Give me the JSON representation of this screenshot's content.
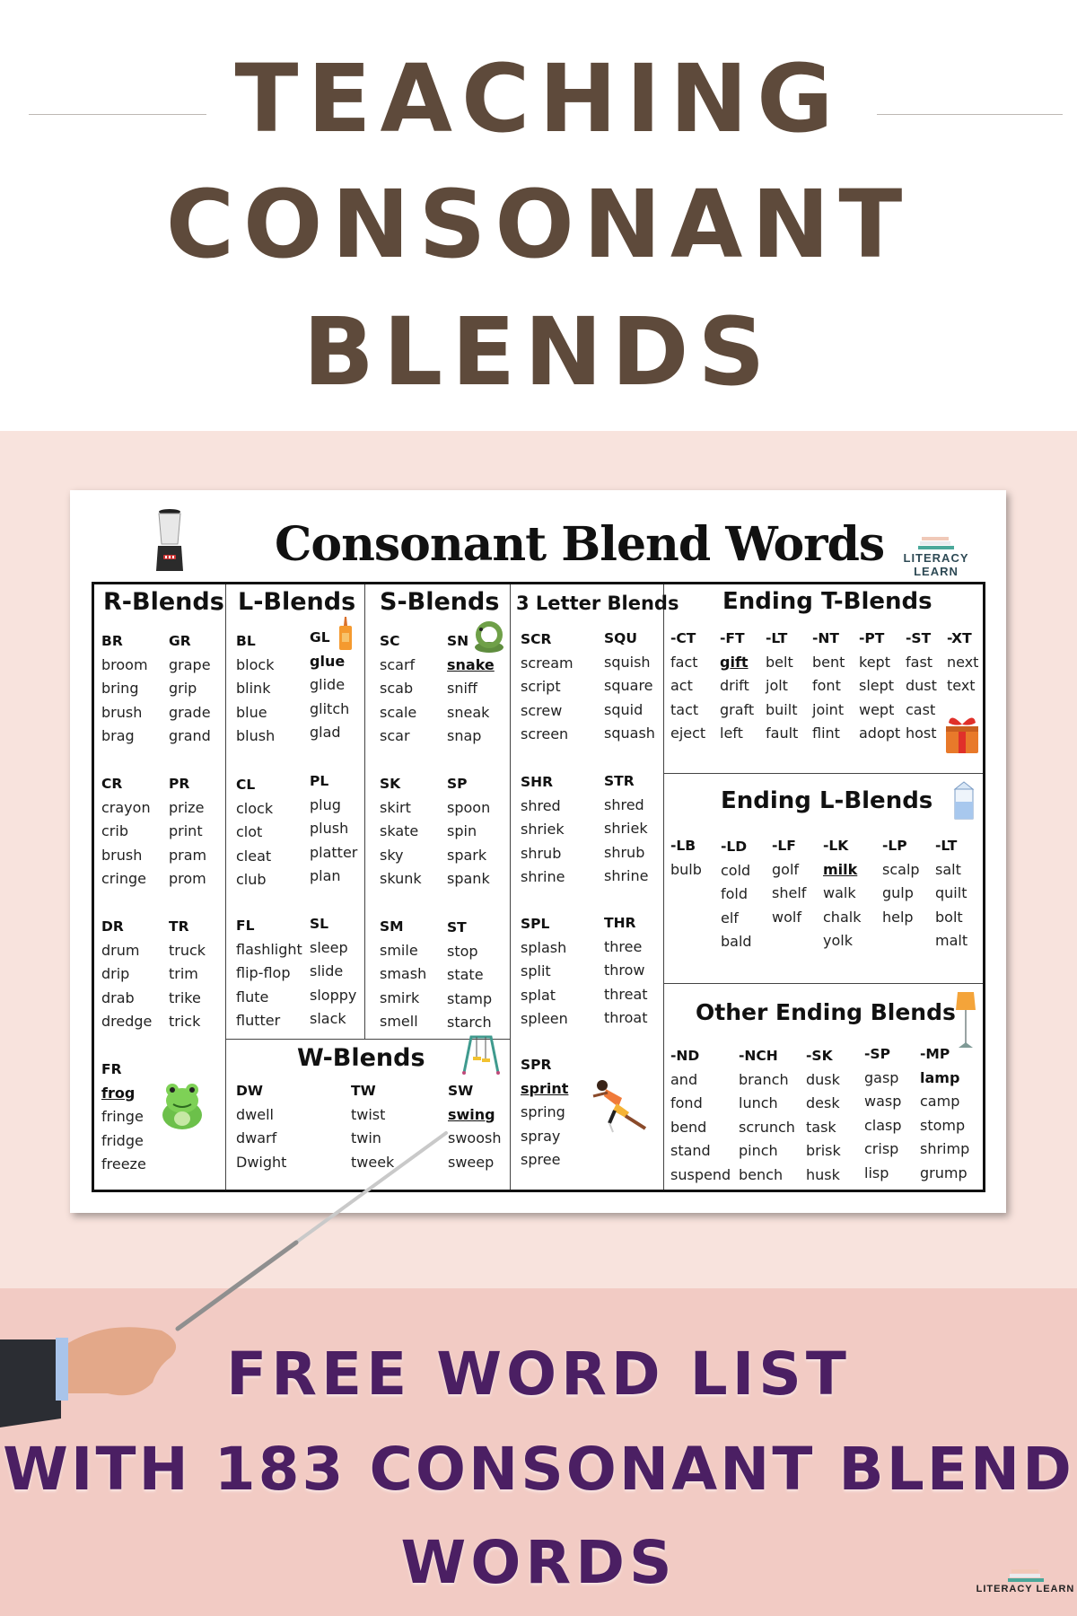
{
  "header": {
    "title_lines": [
      "TEACHING",
      "CONSONANT",
      "BLENDS"
    ]
  },
  "worksheet": {
    "title": "Consonant Blend Words",
    "brand": "LITERACY LEARN",
    "icons": {
      "blender": "blender-icon",
      "glue": "glue-bottle-icon",
      "snake": "snake-icon",
      "frog": "frog-icon",
      "swing": "swing-set-icon",
      "runner": "sprinter-icon",
      "gift": "gift-box-icon",
      "milk": "milk-carton-icon",
      "lamp": "floor-lamp-icon"
    },
    "sections": {
      "r_blends": {
        "title": "R-Blends",
        "groups": [
          {
            "head": "BR",
            "words": [
              "broom",
              "bring",
              "brush",
              "brag"
            ]
          },
          {
            "head": "GR",
            "words": [
              "grape",
              "grip",
              "grade",
              "grand"
            ]
          },
          {
            "head": "CR",
            "words": [
              "crayon",
              "crib",
              "brush",
              "cringe"
            ]
          },
          {
            "head": "PR",
            "words": [
              "prize",
              "print",
              "pram",
              "prom"
            ]
          },
          {
            "head": "DR",
            "words": [
              "drum",
              "drip",
              "drab",
              "dredge"
            ]
          },
          {
            "head": "TR",
            "words": [
              "truck",
              "trim",
              "trike",
              "trick"
            ]
          },
          {
            "head": "FR",
            "words": [
              "frog",
              "fringe",
              "fridge",
              "freeze"
            ],
            "highlight": "frog"
          }
        ]
      },
      "l_blends": {
        "title": "L-Blends",
        "groups": [
          {
            "head": "BL",
            "words": [
              "block",
              "blink",
              "blue",
              "blush"
            ]
          },
          {
            "head": "GL",
            "words": [
              "glue",
              "glide",
              "glitch",
              "glad"
            ],
            "highlight": "glue"
          },
          {
            "head": "CL",
            "words": [
              "clock",
              "clot",
              "cleat",
              "club"
            ]
          },
          {
            "head": "PL",
            "words": [
              "plug",
              "plush",
              "platter",
              "plan"
            ]
          },
          {
            "head": "FL",
            "words": [
              "flashlight",
              "flip-flop",
              "flute",
              "flutter"
            ]
          },
          {
            "head": "SL",
            "words": [
              "sleep",
              "slide",
              "sloppy",
              "slack"
            ]
          }
        ]
      },
      "s_blends": {
        "title": "S-Blends",
        "groups": [
          {
            "head": "SC",
            "words": [
              "scarf",
              "scab",
              "scale",
              "scar"
            ]
          },
          {
            "head": "SN",
            "words": [
              "snake",
              "sniff",
              "sneak",
              "snap"
            ],
            "highlight": "snake"
          },
          {
            "head": "SK",
            "words": [
              "skirt",
              "skate",
              "sky",
              "skunk"
            ]
          },
          {
            "head": "SP",
            "words": [
              "spoon",
              "spin",
              "spark",
              "spank"
            ]
          },
          {
            "head": "SM",
            "words": [
              "smile",
              "smash",
              "smirk",
              "smell"
            ]
          },
          {
            "head": "ST",
            "words": [
              "stop",
              "state",
              "stamp",
              "starch"
            ]
          }
        ]
      },
      "three_letter": {
        "title": "3 Letter Blends",
        "groups": [
          {
            "head": "SCR",
            "words": [
              "scream",
              "script",
              "screw",
              "screen"
            ]
          },
          {
            "head": "SQU",
            "words": [
              "squish",
              "square",
              "squid",
              "squash"
            ]
          },
          {
            "head": "SHR",
            "words": [
              "shred",
              "shriek",
              "shrub",
              "shrine"
            ]
          },
          {
            "head": "STR",
            "words": [
              "shred",
              "shriek",
              "shrub",
              "shrine"
            ]
          },
          {
            "head": "SPL",
            "words": [
              "splash",
              "split",
              "splat",
              "spleen"
            ]
          },
          {
            "head": "THR",
            "words": [
              "three",
              "throw",
              "threat",
              "throat"
            ]
          },
          {
            "head": "SPR",
            "words": [
              "sprint",
              "spring",
              "spray",
              "spree"
            ],
            "highlight": "sprint"
          }
        ]
      },
      "w_blends": {
        "title": "W-Blends",
        "groups": [
          {
            "head": "DW",
            "words": [
              "dwell",
              "dwarf",
              "Dwight"
            ]
          },
          {
            "head": "TW",
            "words": [
              "twist",
              "twin",
              "tweek"
            ]
          },
          {
            "head": "SW",
            "words": [
              "swing",
              "swoosh",
              "sweep"
            ],
            "highlight": "swing"
          }
        ]
      },
      "ending_t": {
        "title": "Ending T-Blends",
        "groups": [
          {
            "head": "-CT",
            "words": [
              "fact",
              "act",
              "tact",
              "eject"
            ]
          },
          {
            "head": "-FT",
            "words": [
              "gift",
              "drift",
              "graft",
              "left"
            ],
            "highlight": "gift"
          },
          {
            "head": "-LT",
            "words": [
              "belt",
              "jolt",
              "built",
              "fault"
            ]
          },
          {
            "head": "-NT",
            "words": [
              "bent",
              "font",
              "joint",
              "flint"
            ]
          },
          {
            "head": "-PT",
            "words": [
              "kept",
              "slept",
              "wept",
              "adopt"
            ]
          },
          {
            "head": "-ST",
            "words": [
              "fast",
              "dust",
              "cast",
              "host"
            ]
          },
          {
            "head": "-XT",
            "words": [
              "next",
              "text"
            ]
          }
        ]
      },
      "ending_l": {
        "title": "Ending L-Blends",
        "groups": [
          {
            "head": "-LB",
            "words": [
              "bulb"
            ]
          },
          {
            "head": "-LD",
            "words": [
              "cold",
              "fold",
              "elf",
              "bald"
            ]
          },
          {
            "head": "-LF",
            "words": [
              "golf",
              "shelf",
              "wolf"
            ]
          },
          {
            "head": "-LK",
            "words": [
              "milk",
              "walk",
              "chalk",
              "yolk"
            ],
            "highlight": "milk"
          },
          {
            "head": "-LP",
            "words": [
              "scalp",
              "gulp",
              "help"
            ]
          },
          {
            "head": "-LT",
            "words": [
              "salt",
              "quilt",
              "bolt",
              "malt"
            ]
          }
        ]
      },
      "other_ending": {
        "title": "Other Ending Blends",
        "groups": [
          {
            "head": "-ND",
            "words": [
              "and",
              "fond",
              "bend",
              "stand",
              "suspend"
            ]
          },
          {
            "head": "-NCH",
            "words": [
              "branch",
              "lunch",
              "scrunch",
              "pinch",
              "bench"
            ]
          },
          {
            "head": "-SK",
            "words": [
              "dusk",
              "desk",
              "task",
              "brisk",
              "husk"
            ]
          },
          {
            "head": "-SP",
            "words": [
              "gasp",
              "wasp",
              "clasp",
              "crisp",
              "lisp"
            ]
          },
          {
            "head": "-MP",
            "words": [
              "lamp",
              "camp",
              "stomp",
              "shrimp",
              "grump"
            ],
            "highlight": "lamp"
          }
        ]
      }
    }
  },
  "footer": {
    "lines": [
      "FREE WORD LIST",
      "WITH 183 CONSONANT BLEND",
      "WORDS"
    ],
    "brand": "LITERACY LEARN"
  },
  "colors": {
    "title_brown": "#5e4a3b",
    "footer_purple": "#4b1f63",
    "band_light_pink": "#f8e3dd",
    "band_dark_pink": "#f2cbc4"
  }
}
